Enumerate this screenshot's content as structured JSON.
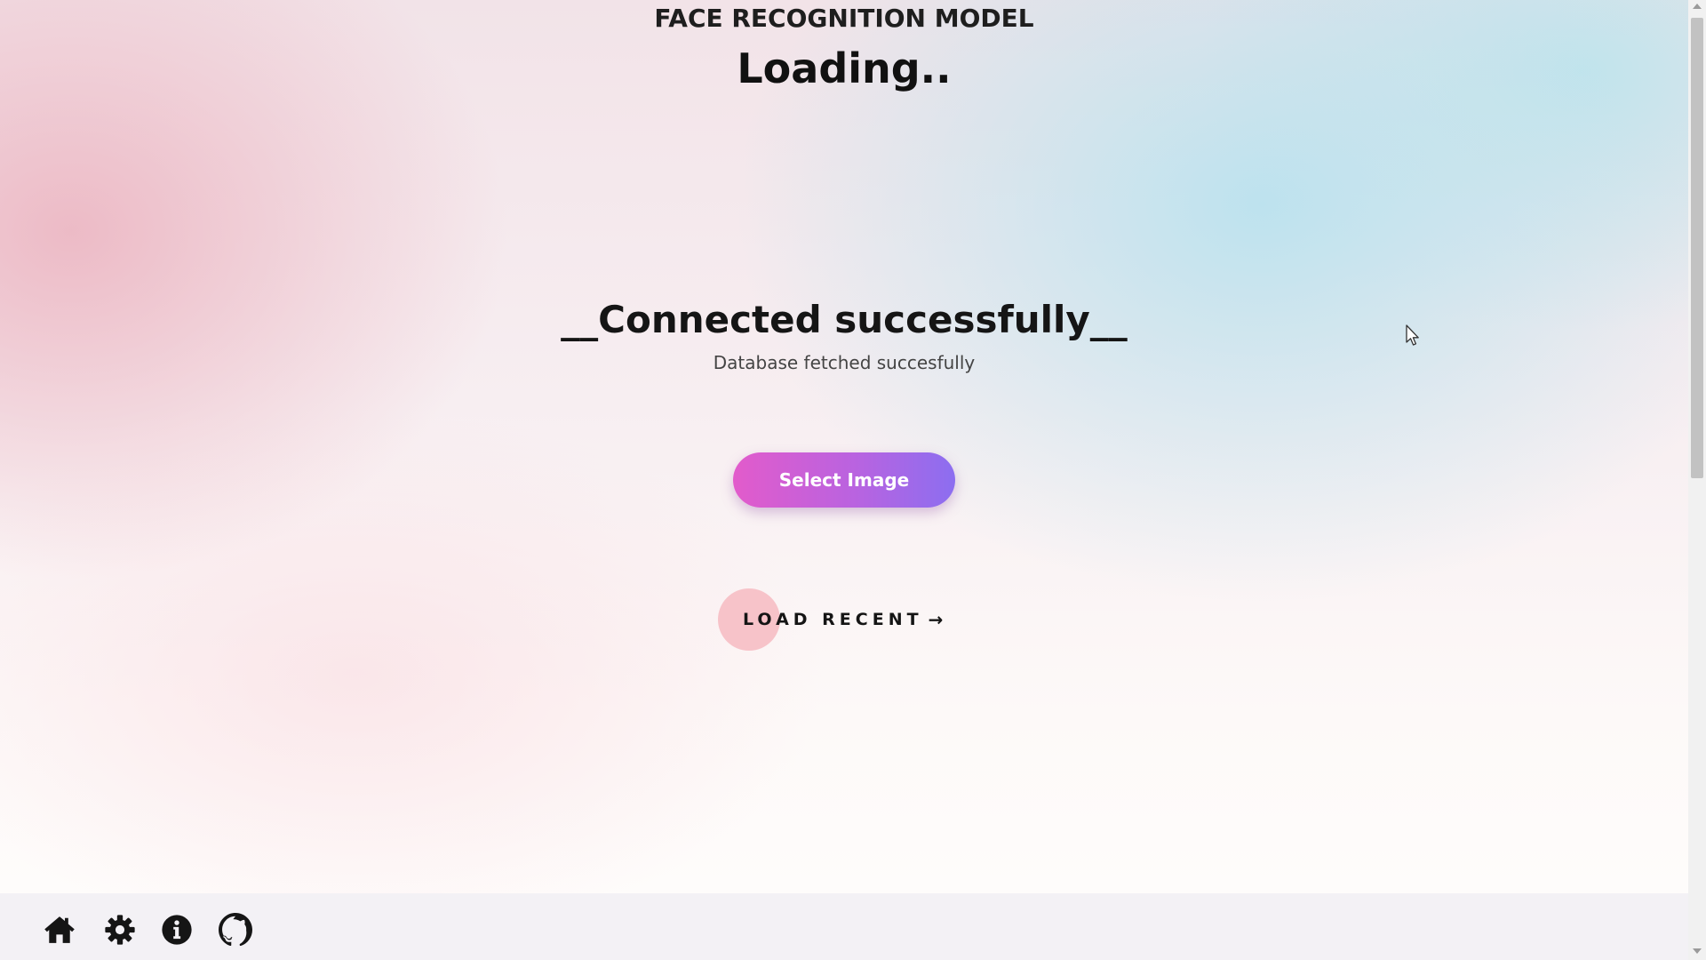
{
  "header": {
    "title": "FACE RECOGNITION MODEL",
    "loading_text": "Loading.."
  },
  "status": {
    "heading": "__Connected successfully__",
    "subtext": "Database fetched succesfully"
  },
  "actions": {
    "select_image_label": "Select Image",
    "load_recent_label": "LOAD RECENT",
    "load_recent_arrow": "→"
  },
  "bottom_nav": {
    "items": [
      {
        "icon": "home-icon"
      },
      {
        "icon": "gear-icon"
      },
      {
        "icon": "info-icon"
      },
      {
        "icon": "github-icon"
      }
    ]
  },
  "colors": {
    "button_gradient_start": "#e25bcb",
    "button_gradient_end": "#8c6ef0",
    "load_recent_circle": "#f6bec4",
    "text_primary": "#151515",
    "bottom_bar_bg": "#f3f1f5"
  }
}
